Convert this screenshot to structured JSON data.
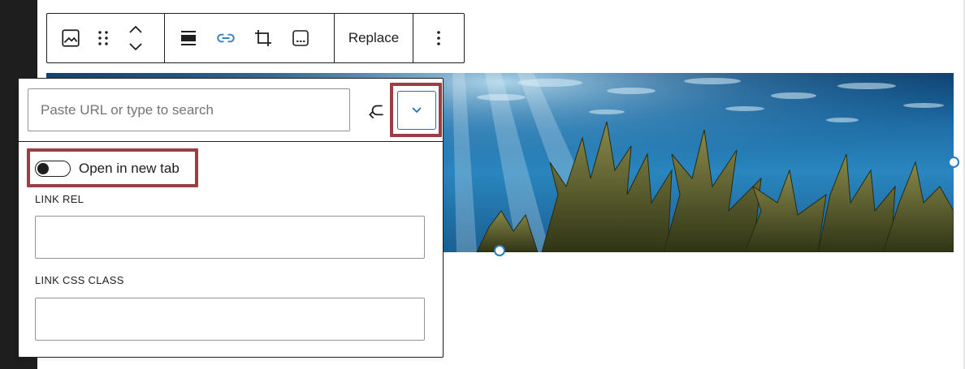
{
  "toolbar": {
    "replace_label": "Replace",
    "icons": [
      "image-icon",
      "drag-handle-icon",
      "move-up-down-icon",
      "align-icon",
      "link-icon",
      "crop-icon",
      "caption-icon",
      "more-options-icon"
    ],
    "link_active_color": "#3582c4"
  },
  "image": {
    "description_colors": [
      "#0d3f6e",
      "#2a86bf",
      "#3d4a1f"
    ]
  },
  "link_popover": {
    "search_placeholder": "Paste URL or type to search",
    "search_value": "",
    "open_in_new_tab_label": "Open in new tab",
    "open_in_new_tab_enabled": false,
    "link_rel_label": "LINK REL",
    "link_rel_value": "",
    "link_css_class_label": "LINK CSS CLASS",
    "link_css_class_value": ""
  },
  "colors": {
    "highlight": "#9b3e45",
    "accent": "#2271b1",
    "sidebar": "#1e1e1e"
  }
}
